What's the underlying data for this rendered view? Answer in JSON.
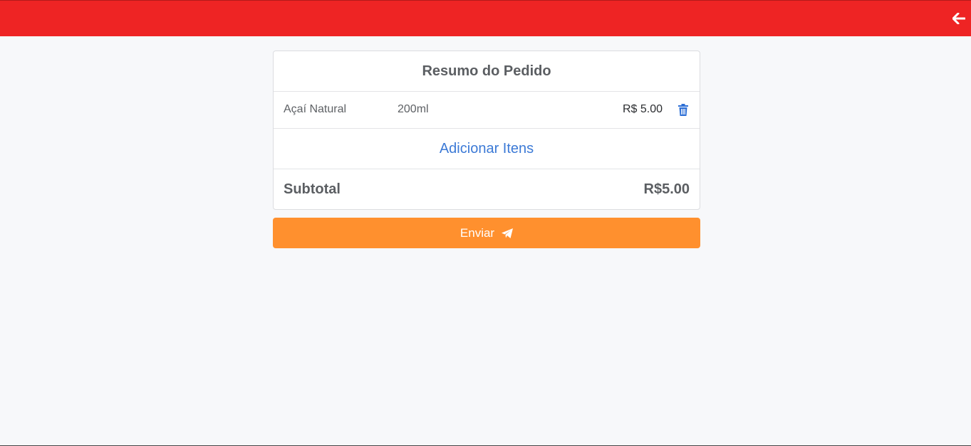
{
  "header": {
    "back_icon": "arrow-left-icon",
    "background_color": "#ee2424"
  },
  "order": {
    "title": "Resumo do Pedido",
    "items": [
      {
        "name": "Açaí Natural",
        "size": "200ml",
        "price": "R$ 5.00",
        "delete_icon": "trash-icon"
      }
    ],
    "add_items_label": "Adicionar Itens",
    "subtotal_label": "Subtotal",
    "subtotal_value": "R$5.00"
  },
  "actions": {
    "send_label": "Enviar",
    "send_icon": "paper-plane-icon",
    "send_color": "#ff902e"
  },
  "colors": {
    "link": "#3c7ad6",
    "trash": "#2d6fd6"
  }
}
